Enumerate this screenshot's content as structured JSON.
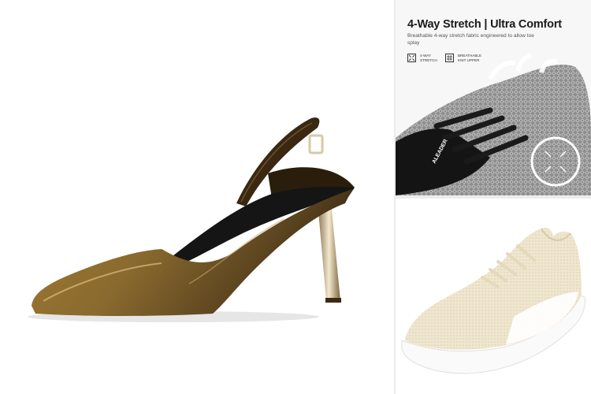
{
  "top_right": {
    "title": "4-Way Stretch | Ultra Comfort",
    "description": "Breathable 4-way stretch fabric engineered to allow toe splay",
    "features": [
      {
        "icon": "stretch-arrows-icon",
        "label": "4-WAY STRETCH"
      },
      {
        "icon": "knit-fabric-icon",
        "label": "BREATHABLE KNIT UPPER"
      }
    ],
    "brand_on_shoe": "ALEADER"
  },
  "colors": {
    "heel_patent": "#8a6a2e",
    "sneaker_cream": "#efe6cf",
    "knit_grey": "#9c9c9c"
  }
}
